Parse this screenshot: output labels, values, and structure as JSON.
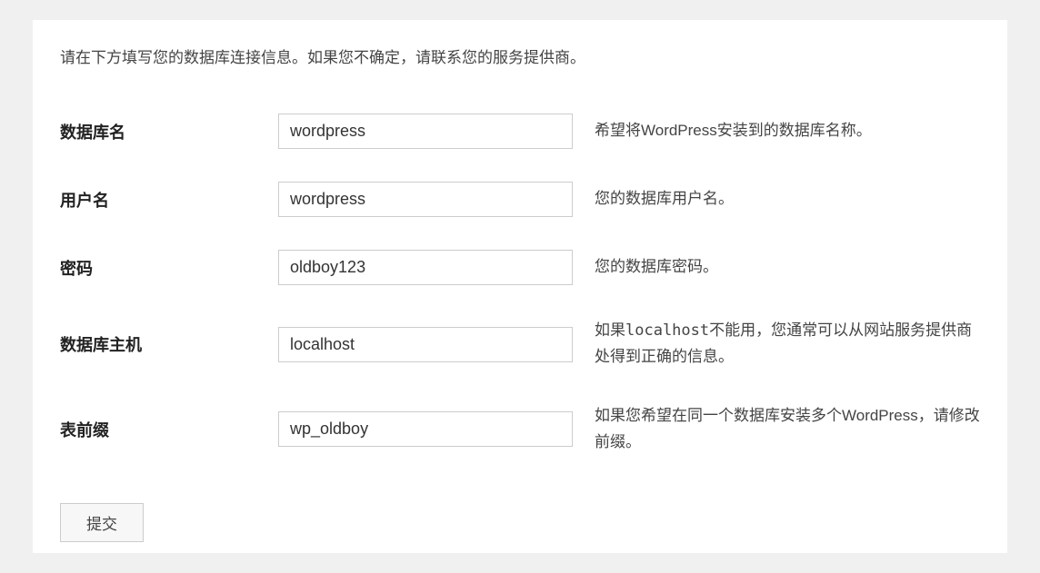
{
  "intro": "请在下方填写您的数据库连接信息。如果您不确定，请联系您的服务提供商。",
  "fields": {
    "dbname": {
      "label": "数据库名",
      "value": "wordpress",
      "desc": "希望将WordPress安装到的数据库名称。"
    },
    "uname": {
      "label": "用户名",
      "value": "wordpress",
      "desc": "您的数据库用户名。"
    },
    "pwd": {
      "label": "密码",
      "value": "oldboy123",
      "desc": "您的数据库密码。"
    },
    "dbhost": {
      "label": "数据库主机",
      "value": "localhost",
      "desc_pre": "如果",
      "desc_code": "localhost",
      "desc_post": "不能用，您通常可以从网站服务提供商处得到正确的信息。"
    },
    "prefix": {
      "label": "表前缀",
      "value": "wp_oldboy",
      "desc": "如果您希望在同一个数据库安装多个WordPress，请修改前缀。"
    }
  },
  "submit_label": "提交"
}
